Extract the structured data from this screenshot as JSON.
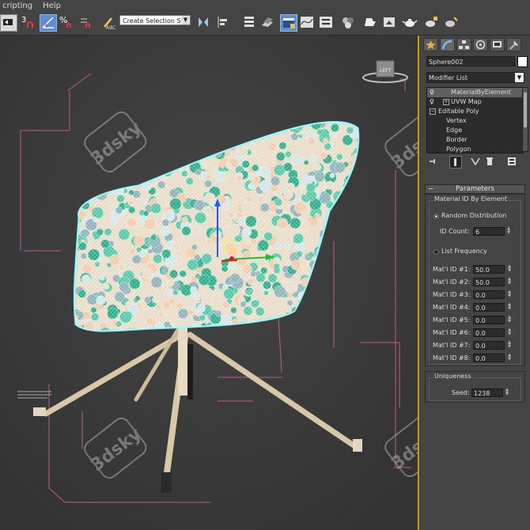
{
  "menu": [
    "cripting",
    "Help"
  ],
  "toolbar": {
    "selection_set": "Create Selection Se",
    "snap_label": "3",
    "percent_label": "%"
  },
  "viewport": {
    "watermark": "3dsky",
    "viewcube_label": "LEFT",
    "chair_colors": [
      "#e9ddc8",
      "#2fae8d",
      "#8fb4bb",
      "#f1ccac",
      "#d5e6e8",
      "#56c9a8"
    ]
  },
  "panel": {
    "object_name": "Sphere002",
    "modifier_list": "Modifier List",
    "stack": [
      {
        "label": "MaterialByElement",
        "indent": 1,
        "selected": true
      },
      {
        "label": "UVW Map",
        "indent": 1,
        "selected": false
      },
      {
        "label": "Editable Poly",
        "indent": 0,
        "selected": false
      },
      {
        "label": "Vertex",
        "indent": 2,
        "selected": false
      },
      {
        "label": "Edge",
        "indent": 2,
        "selected": false
      },
      {
        "label": "Border",
        "indent": 2,
        "selected": false
      },
      {
        "label": "Polygon",
        "indent": 2,
        "selected": false
      }
    ],
    "parameters": {
      "title": "Parameters",
      "group_title": "Material ID By Element",
      "random_distribution": "Random Distribution",
      "id_count_label": "ID Count:",
      "id_count_value": "6",
      "list_frequency": "List Frequency",
      "mat_ids": [
        {
          "label": "Mat'l ID #1:",
          "value": "50.0"
        },
        {
          "label": "Mat'l ID #2:",
          "value": "50.0"
        },
        {
          "label": "Mat'l ID #3:",
          "value": "0.0"
        },
        {
          "label": "Mat'l ID #4:",
          "value": "0.0"
        },
        {
          "label": "Mat'l ID #5:",
          "value": "0.0"
        },
        {
          "label": "Mat'l ID #6:",
          "value": "0.0"
        },
        {
          "label": "Mat'l ID #7:",
          "value": "0.0"
        },
        {
          "label": "Mat'l ID #8:",
          "value": "0.0"
        }
      ]
    },
    "uniqueness": {
      "title": "Uniqueness",
      "seed_label": "Seed:",
      "seed_value": "1238"
    }
  }
}
